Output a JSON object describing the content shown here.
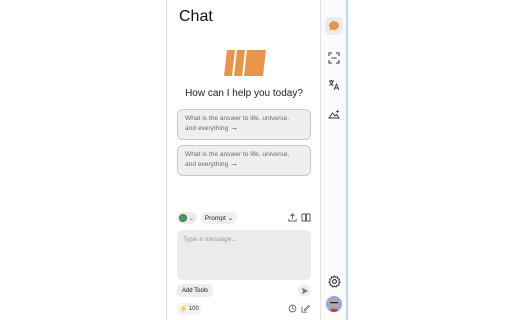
{
  "header": {
    "title": "Chat"
  },
  "greeting": "How can I help you today?",
  "suggestions": [
    {
      "line1": "What is the answer to life, universe,",
      "line2": "and everything",
      "arrow": "→"
    },
    {
      "line1": "What is the answer to life, universe,",
      "line2": "and everything",
      "arrow": "→"
    }
  ],
  "toolbar": {
    "prompt_label": "Prompt",
    "prompt_chevron": "⌄",
    "model_chevron": "⌄"
  },
  "input": {
    "placeholder": "Type a message..."
  },
  "footer": {
    "add_tools_label": "Add Tools",
    "credits": "100"
  },
  "colors": {
    "accent": "#e8944a",
    "model_dot": "#4f9a6b",
    "rail_border": "#bcd6f0"
  },
  "rail": {
    "items": [
      {
        "name": "chat-icon",
        "active": true
      },
      {
        "name": "scan-icon",
        "active": false
      },
      {
        "name": "translate-icon",
        "active": false
      },
      {
        "name": "image-icon",
        "active": false
      },
      {
        "name": "gear-icon",
        "active": false
      }
    ]
  }
}
